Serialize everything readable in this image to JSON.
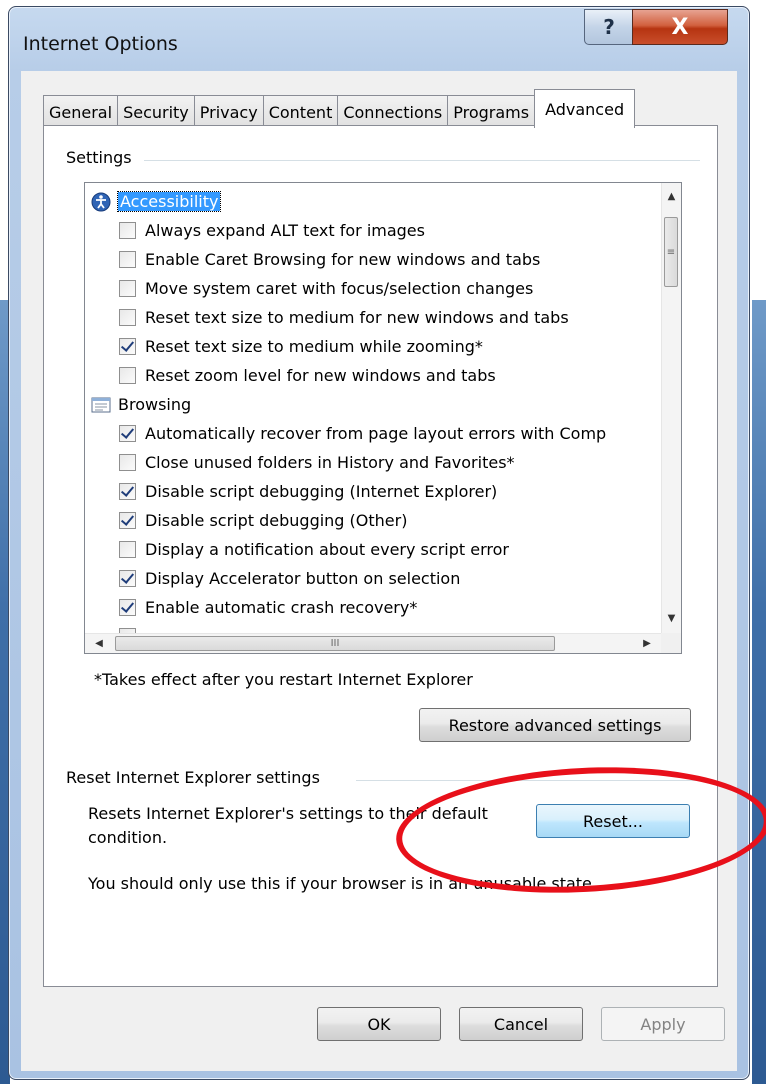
{
  "window": {
    "title": "Internet Options",
    "help_glyph": "?",
    "close_glyph": "X"
  },
  "tabs": [
    {
      "label": "General",
      "active": false
    },
    {
      "label": "Security",
      "active": false
    },
    {
      "label": "Privacy",
      "active": false
    },
    {
      "label": "Content",
      "active": false
    },
    {
      "label": "Connections",
      "active": false
    },
    {
      "label": "Programs",
      "active": false
    },
    {
      "label": "Advanced",
      "active": true
    }
  ],
  "settings": {
    "group_label": "Settings",
    "items": [
      {
        "kind": "category",
        "icon": "accessibility-icon",
        "label": "Accessibility",
        "selected": true
      },
      {
        "kind": "option",
        "label": "Always expand ALT text for images",
        "checked": false
      },
      {
        "kind": "option",
        "label": "Enable Caret Browsing for new windows and tabs",
        "checked": false
      },
      {
        "kind": "option",
        "label": "Move system caret with focus/selection changes",
        "checked": false
      },
      {
        "kind": "option",
        "label": "Reset text size to medium for new windows and tabs",
        "checked": false
      },
      {
        "kind": "option",
        "label": "Reset text size to medium while zooming*",
        "checked": true
      },
      {
        "kind": "option",
        "label": "Reset zoom level for new windows and tabs",
        "checked": false
      },
      {
        "kind": "category",
        "icon": "browsing-icon",
        "label": "Browsing",
        "selected": false
      },
      {
        "kind": "option",
        "label": "Automatically recover from page layout errors with Comp",
        "checked": true
      },
      {
        "kind": "option",
        "label": "Close unused folders in History and Favorites*",
        "checked": false
      },
      {
        "kind": "option",
        "label": "Disable script debugging (Internet Explorer)",
        "checked": true
      },
      {
        "kind": "option",
        "label": "Disable script debugging (Other)",
        "checked": true
      },
      {
        "kind": "option",
        "label": "Display a notification about every script error",
        "checked": false
      },
      {
        "kind": "option",
        "label": "Display Accelerator button on selection",
        "checked": true
      },
      {
        "kind": "option",
        "label": "Enable automatic crash recovery*",
        "checked": true
      }
    ],
    "scroll_glyphs": {
      "up": "▲",
      "down": "▼",
      "left": "◀",
      "right": "▶",
      "grip_v": "≡",
      "grip_h": "III"
    }
  },
  "restart_note": "*Takes effect after you restart Internet Explorer",
  "restore_button": "Restore advanced settings",
  "reset": {
    "group_label": "Reset Internet Explorer settings",
    "description": "Resets Internet Explorer's settings to their default condition.",
    "button": "Reset...",
    "warning": "You should only use this if your browser is in an unusable state."
  },
  "footer": {
    "ok": "OK",
    "cancel": "Cancel",
    "apply": "Apply"
  },
  "colors": {
    "annotation_circle": "#e8101a",
    "selection": "#3399ff"
  }
}
